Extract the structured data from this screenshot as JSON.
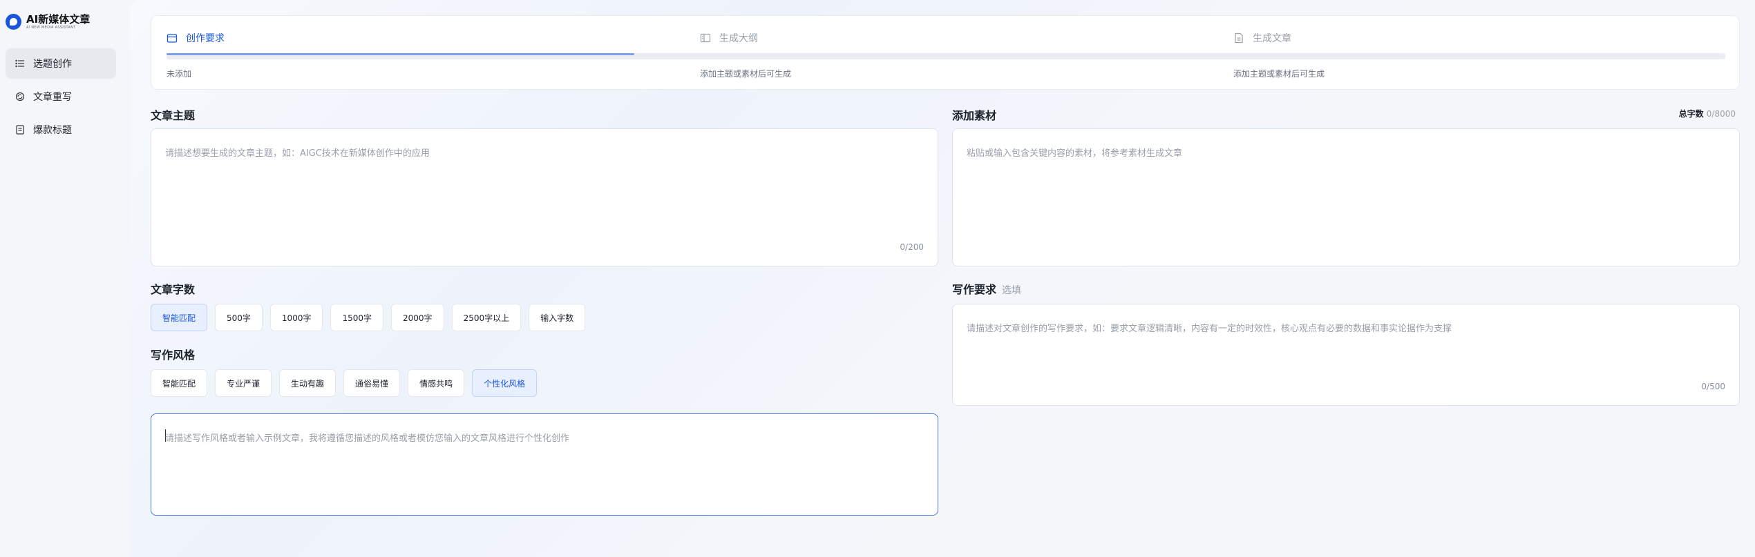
{
  "brand": {
    "name": "AI新媒体文章",
    "subtitle": "AI NEW MEDIA ASSISTANT"
  },
  "nav": [
    {
      "label": "选题创作",
      "icon": "list-icon",
      "active": true
    },
    {
      "label": "文章重写",
      "icon": "rewrite-icon",
      "active": false
    },
    {
      "label": "爆款标题",
      "icon": "document-icon",
      "active": false
    }
  ],
  "steps": [
    {
      "label": "创作要求",
      "desc": "未添加",
      "icon": "calendar-icon",
      "active": true
    },
    {
      "label": "生成大纲",
      "desc": "添加主题或素材后可生成",
      "icon": "outline-icon",
      "active": false
    },
    {
      "label": "生成文章",
      "desc": "添加主题或素材后可生成",
      "icon": "file-icon",
      "active": false
    }
  ],
  "progress": 0.3,
  "topic": {
    "title": "文章主题",
    "placeholder": "请描述想要生成的文章主题，如：AIGC技术在新媒体创作中的应用",
    "count": "0/200"
  },
  "material": {
    "title": "添加素材",
    "total_label": "总字数",
    "total_value": "0/8000",
    "placeholder": "粘贴或输入包含关键内容的素材，将参考素材生成文章"
  },
  "word_count": {
    "title": "文章字数",
    "options": [
      "智能匹配",
      "500字",
      "1000字",
      "1500字",
      "2000字",
      "2500字以上",
      "输入字数"
    ],
    "selected": "智能匹配"
  },
  "style": {
    "title": "写作风格",
    "options": [
      "智能匹配",
      "专业严谨",
      "生动有趣",
      "通俗易懂",
      "情感共鸣",
      "个性化风格"
    ],
    "selected": "个性化风格",
    "custom_placeholder": "请描述写作风格或者输入示例文章，我将遵循您描述的风格或者模仿您输入的文章风格进行个性化创作"
  },
  "requirements": {
    "title": "写作要求",
    "optional": "选填",
    "placeholder": "请描述对文章创作的写作要求，如：要求文章逻辑清晰，内容有一定的时效性，核心观点有必要的数据和事实论据作为支撑",
    "count": "0/500"
  }
}
